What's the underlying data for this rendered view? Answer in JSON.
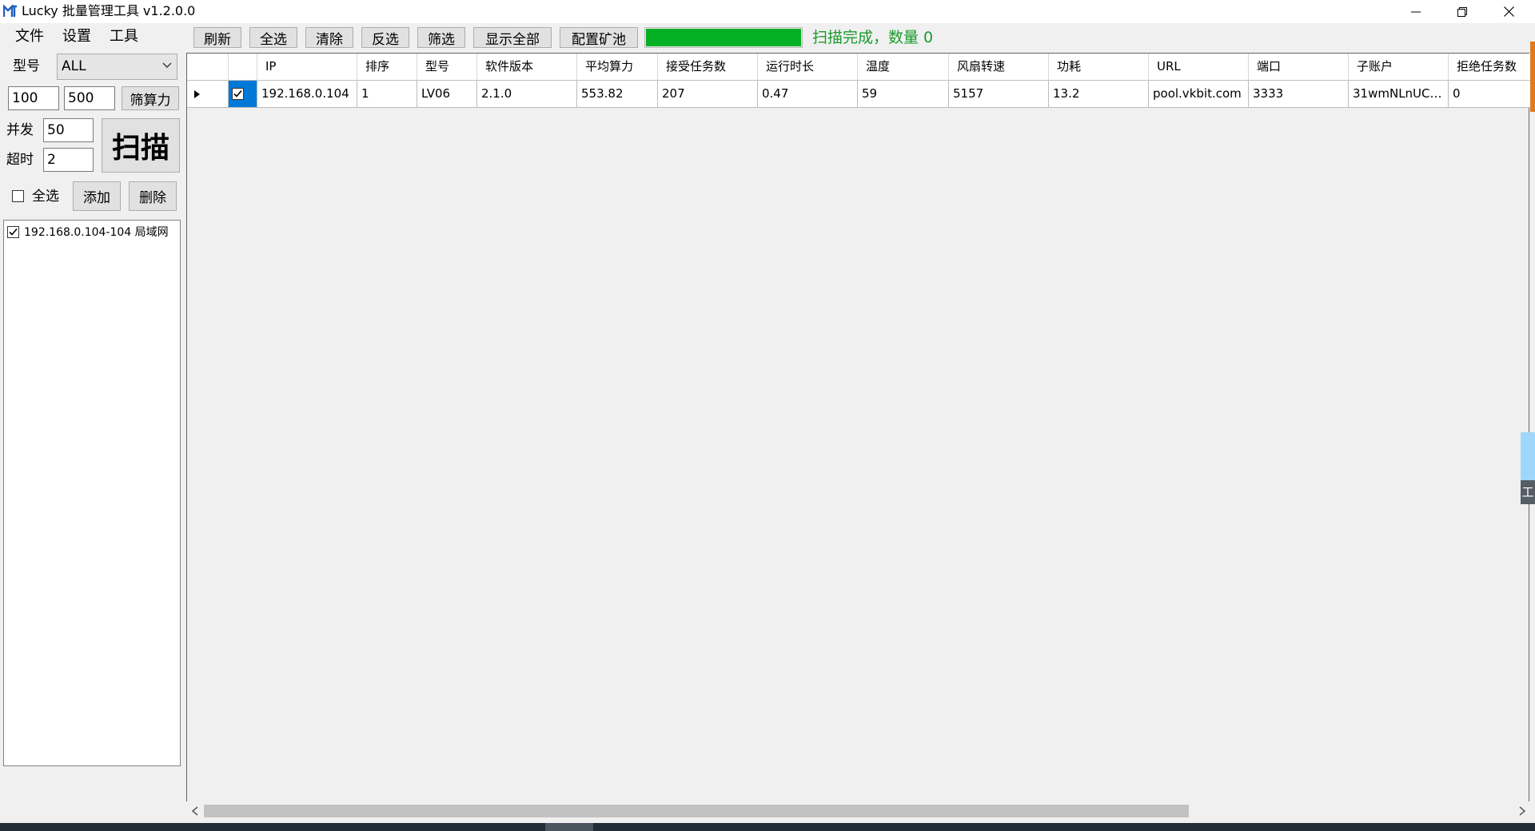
{
  "window": {
    "title": "Lucky 批量管理工具 v1.2.0.0",
    "controls": {
      "minimize": "–",
      "maximize": "❐",
      "close": "✕"
    }
  },
  "menu": {
    "items": [
      "文件",
      "设置",
      "工具"
    ]
  },
  "toolbar": {
    "buttons": [
      "刷新",
      "全选",
      "清除",
      "反选",
      "筛选",
      "显示全部",
      "配置矿池"
    ],
    "progress_fraction": 1.0,
    "status": "扫描完成，数量 0",
    "progress_color": "#06b025"
  },
  "left_panel": {
    "model_label": "型号",
    "model_value": "ALL",
    "hash_min": "100",
    "hash_max": "500",
    "filter_hash_button": "筛算力",
    "concurrency_label": "并发",
    "concurrency_value": "50",
    "timeout_label": "超时",
    "timeout_value": "2",
    "scan_button": "扫描",
    "select_all_label": "全选",
    "add_button": "添加",
    "delete_button": "删除",
    "ranges": [
      {
        "label": "192.168.0.104-104 局域网",
        "checked": true
      }
    ]
  },
  "grid": {
    "columns": [
      "IP",
      "排序",
      "型号",
      "软件版本",
      "平均算力",
      "接受任务数",
      "运行时长",
      "温度",
      "风扇转速",
      "功耗",
      "URL",
      "端口",
      "子账户",
      "拒绝任务数"
    ],
    "rows": [
      {
        "checked": true,
        "cells": [
          "192.168.0.104",
          "1",
          "LV06",
          "2.1.0",
          "553.82",
          "207",
          "0.47",
          "59",
          "5157",
          "13.2",
          "pool.vkbit.com",
          "3333",
          "31wmNLnUC5...",
          "0"
        ]
      }
    ]
  },
  "edge": {
    "tab_text": "工"
  },
  "colors": {
    "accent": "#0078d7",
    "status_green": "#1a9a2c",
    "progress_green": "#06b025"
  }
}
